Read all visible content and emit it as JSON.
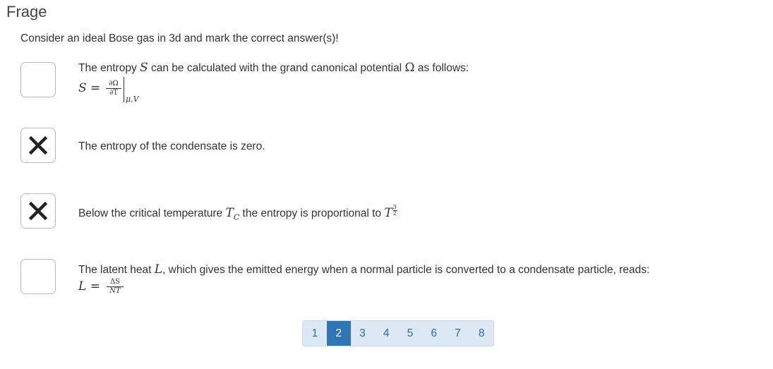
{
  "header": {
    "title": "Frage"
  },
  "question": {
    "text": "Consider an ideal Bose gas in 3d and mark the correct answer(s)!"
  },
  "answers": [
    {
      "checked": false,
      "text_a": "The entropy ",
      "sym_a": "S",
      "text_b": " can be calculated with the grand canonical potential ",
      "sym_b": "Ω",
      "text_c": " as follows:",
      "formula_lhs": "S =",
      "frac_num": "∂Ω",
      "frac_den": "∂T",
      "subscript": "μ,V"
    },
    {
      "checked": true,
      "text": "The entropy of the condensate is zero."
    },
    {
      "checked": true,
      "text_a": "Below the critical temperature ",
      "sym_a": "T",
      "sub_a": "C",
      "text_b": " the entropy is proportional to ",
      "sym_b": "T",
      "exp_num": "3",
      "exp_den": "2"
    },
    {
      "checked": false,
      "text_a": "The latent heat ",
      "sym_a": "L",
      "text_b": ", which gives the emitted energy when a normal particle is converted to a condensate particle, reads:",
      "formula_lhs": "L =",
      "frac_num": "ΔS",
      "frac_den": "NT"
    }
  ],
  "pagination": {
    "pages": [
      "1",
      "2",
      "3",
      "4",
      "5",
      "6",
      "7",
      "8"
    ],
    "active": "2"
  },
  "colors": {
    "accent": "#2f74b5",
    "pager_bg": "#dce8f3",
    "text": "#333333"
  },
  "icons": {
    "checked_mark": "x-mark-icon"
  }
}
